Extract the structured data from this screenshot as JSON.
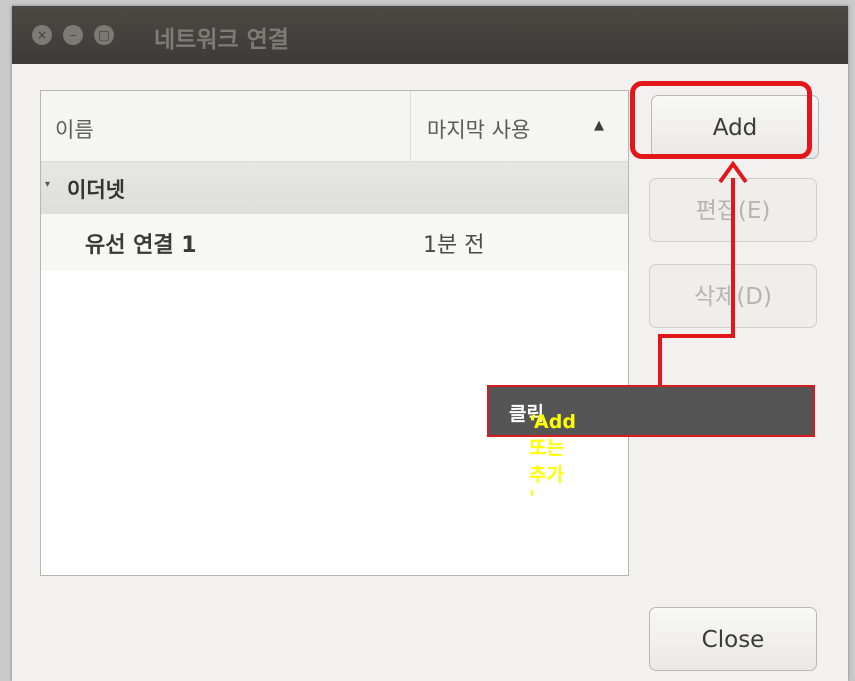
{
  "window": {
    "title": "네트워크 연결",
    "controls": {
      "close": "×",
      "minimize": "–",
      "maximize": "□"
    }
  },
  "list": {
    "columns": [
      "이름",
      "마지막 사용"
    ],
    "sort_indicator": "▲",
    "group": {
      "expander": "▾",
      "name": "이더넷"
    },
    "rows": [
      {
        "name": "유선 연결 1",
        "last_used": "1분 전"
      }
    ]
  },
  "buttons": {
    "add": "Add",
    "edit": "편집(E)",
    "delete": "삭제(D)",
    "close": "Close"
  },
  "annotation": {
    "text_highlight": "‘Add 또는 추가 '",
    "text_rest": " 클릭",
    "color_highlight": "#e3161a"
  }
}
